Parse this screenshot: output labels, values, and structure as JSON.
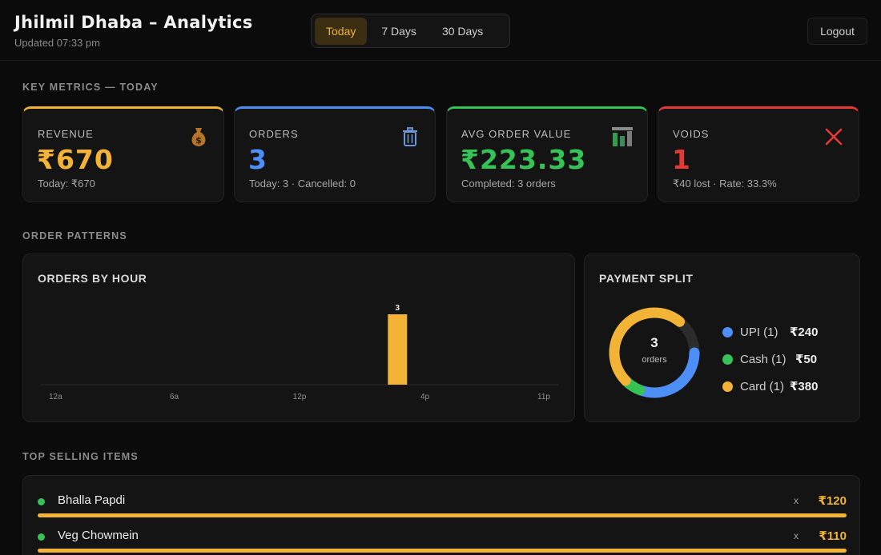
{
  "header": {
    "title": "Jhilmil Dhaba – Analytics",
    "updated": "Updated 07:33 pm",
    "range_tabs": [
      {
        "label": "Today",
        "active": true
      },
      {
        "label": "7 Days",
        "active": false
      },
      {
        "label": "30 Days",
        "active": false
      }
    ],
    "logout_label": "Logout"
  },
  "sections": {
    "key_metrics": "KEY METRICS — TODAY",
    "order_patterns": "ORDER PATTERNS",
    "top_selling": "TOP SELLING ITEMS"
  },
  "metrics": [
    {
      "label": "REVENUE",
      "value": "₹670",
      "sub": "Today: ₹670",
      "color": "#f3b336",
      "icon": "money-bag-icon"
    },
    {
      "label": "ORDERS",
      "value": "3",
      "sub": "Today: 3 · Cancelled: 0",
      "color": "#4d8ef7",
      "icon": "trash-icon"
    },
    {
      "label": "AVG ORDER VALUE",
      "value": "₹223.33",
      "sub": "Completed: 3 orders",
      "color": "#35c257",
      "icon": "bar-chart-icon"
    },
    {
      "label": "VOIDS",
      "value": "1",
      "sub": "₹40 lost · Rate: 33.3%",
      "color": "#e53935",
      "icon": "close-icon"
    }
  ],
  "orders_by_hour": {
    "title": "ORDERS BY HOUR",
    "chart_data": {
      "type": "bar",
      "x_ticks": [
        "12a",
        "6a",
        "12p",
        "4p",
        "11p"
      ],
      "bars": [
        {
          "hour": 15,
          "value": 3,
          "label": "3"
        }
      ],
      "hour_range": [
        0,
        23
      ],
      "ylim": [
        0,
        3
      ],
      "bar_color": "#f3b336",
      "grid": false
    }
  },
  "payment_split": {
    "title": "PAYMENT SPLIT",
    "center_value": "3",
    "center_label": "orders",
    "chart_data": {
      "type": "pie",
      "segments": [
        {
          "name": "UPI (1)",
          "amount": "₹240",
          "value": 240,
          "color": "#4d8ef7"
        },
        {
          "name": "Cash (1)",
          "amount": "₹50",
          "value": 50,
          "color": "#35c257"
        },
        {
          "name": "Card (1)",
          "amount": "₹380",
          "value": 380,
          "color": "#f3b336"
        }
      ]
    }
  },
  "top_items": [
    {
      "name": "Bhalla Papdi",
      "qty": "x",
      "price": "₹120",
      "share": 1.0
    },
    {
      "name": "Veg Chowmein",
      "qty": "x",
      "price": "₹110",
      "share": 1.0
    }
  ]
}
